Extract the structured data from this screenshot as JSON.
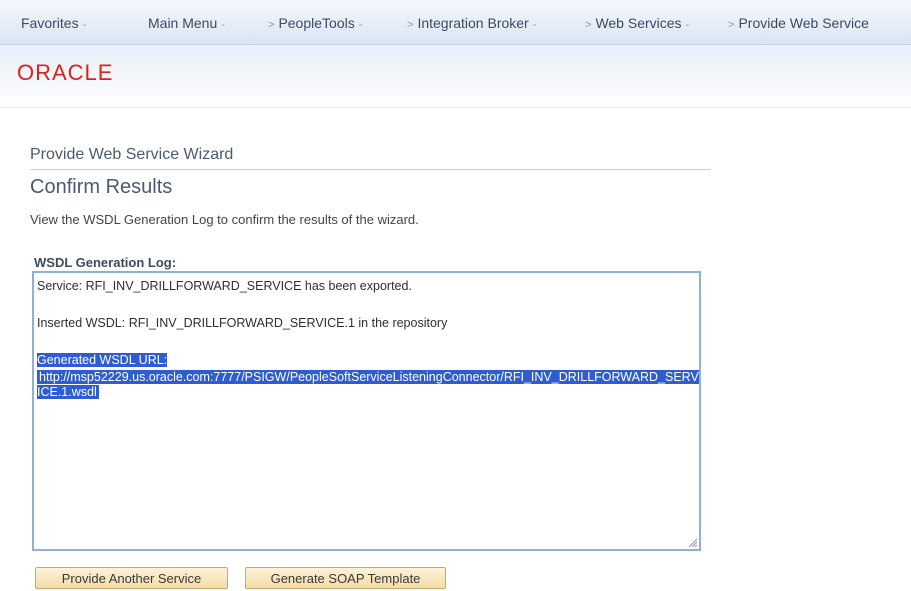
{
  "nav": {
    "items": [
      {
        "label": "Favorites",
        "chevron": "-"
      },
      {
        "label": "Main Menu",
        "chevron": "-"
      },
      {
        "label": "PeopleTools",
        "chevron": "-"
      },
      {
        "label": "Integration Broker",
        "chevron": "-"
      },
      {
        "label": "Web Services",
        "chevron": "-"
      },
      {
        "label": "Provide Web Service",
        "chevron": ""
      }
    ],
    "separator": ">"
  },
  "branding": {
    "logo_text": "ORACLE",
    "logo_color": "#e0201b"
  },
  "page": {
    "wizard_title": "Provide Web Service Wizard",
    "step_title": "Confirm Results",
    "instructions": "View the WSDL Generation Log to confirm the results of the wizard."
  },
  "log": {
    "label": "WSDL Generation Log:",
    "line_exported": "Service: RFI_INV_DRILLFORWARD_SERVICE has been exported.",
    "line_inserted": "Inserted WSDL: RFI_INV_DRILLFORWARD_SERVICE.1 in the repository",
    "line_url_label": "Generated WSDL URL:",
    "url": "http://msp52229.us.oracle.com:7777/PSIGW/PeopleSoftServiceListeningConnector/RFI_INV_DRILLFORWARD_SERVICE.1.wsdl",
    "highlight_color": "#2e5cd3"
  },
  "buttons": {
    "provide_another": "Provide Another Service",
    "generate_soap": "Generate SOAP Template"
  },
  "icons": {
    "resize": "resize-grip-icon"
  }
}
